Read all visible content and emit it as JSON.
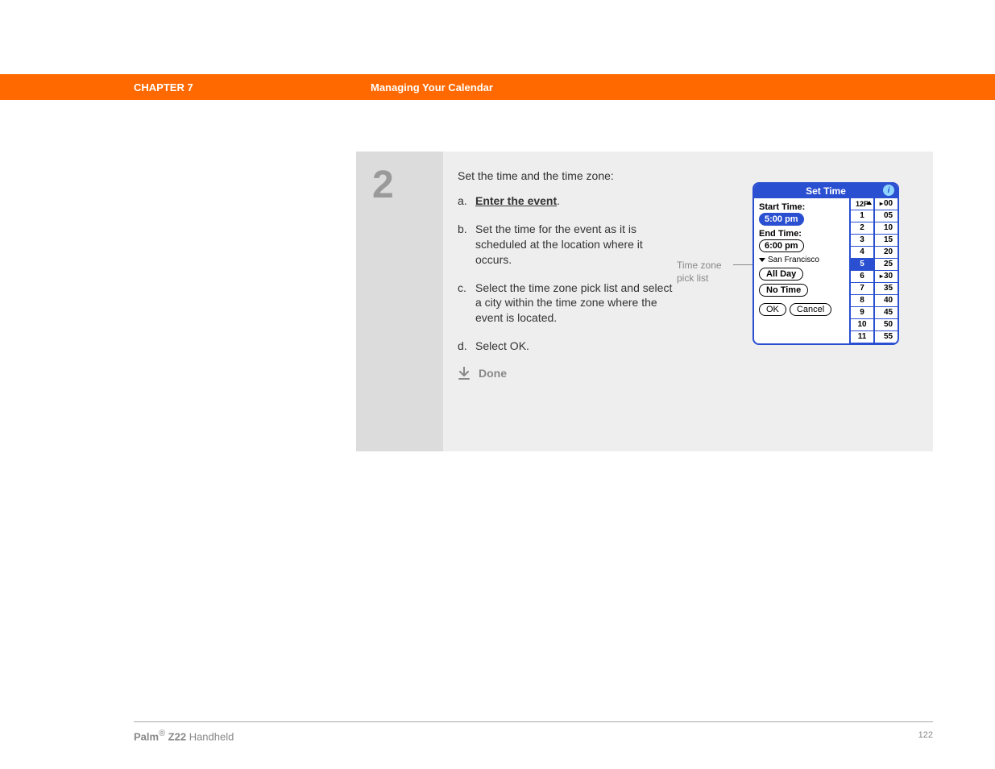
{
  "header": {
    "chapter": "CHAPTER 7",
    "title": "Managing Your Calendar"
  },
  "step": {
    "number": "2",
    "intro": "Set the time and the time zone:",
    "items": {
      "a": {
        "marker": "a.",
        "text": "Enter the event",
        "suffix": "."
      },
      "b": {
        "marker": "b.",
        "text": "Set the time for the event as it is scheduled at the location where it occurs."
      },
      "c": {
        "marker": "c.",
        "text": "Select the time zone pick list and select a city within the time zone where the event is located."
      },
      "d": {
        "marker": "d.",
        "text": "Select OK."
      }
    },
    "done": "Done"
  },
  "callout": {
    "line1": "Time zone",
    "line2": "pick list"
  },
  "palm": {
    "title": "Set Time",
    "start_label": "Start Time:",
    "start_value": "5:00 pm",
    "end_label": "End Time:",
    "end_value": "6:00 pm",
    "tz_value": "San Francisco",
    "all_day": "All Day",
    "no_time": "No Time",
    "ok": "OK",
    "cancel": "Cancel",
    "hours": {
      "ampm": "12P",
      "h1": "1",
      "h2": "2",
      "h3": "3",
      "h4": "4",
      "h5": "5",
      "h6": "6",
      "h7": "7",
      "h8": "8",
      "h9": "9",
      "h10": "10",
      "h11": "11"
    },
    "mins": {
      "m00": "00",
      "m05": "05",
      "m10": "10",
      "m15": "15",
      "m20": "20",
      "m25": "25",
      "m30": "30",
      "m35": "35",
      "m40": "40",
      "m45": "45",
      "m50": "50",
      "m55": "55"
    }
  },
  "footer": {
    "brand": "Palm",
    "reg": "®",
    "model": " Z22",
    "product": " Handheld",
    "page": "122"
  }
}
